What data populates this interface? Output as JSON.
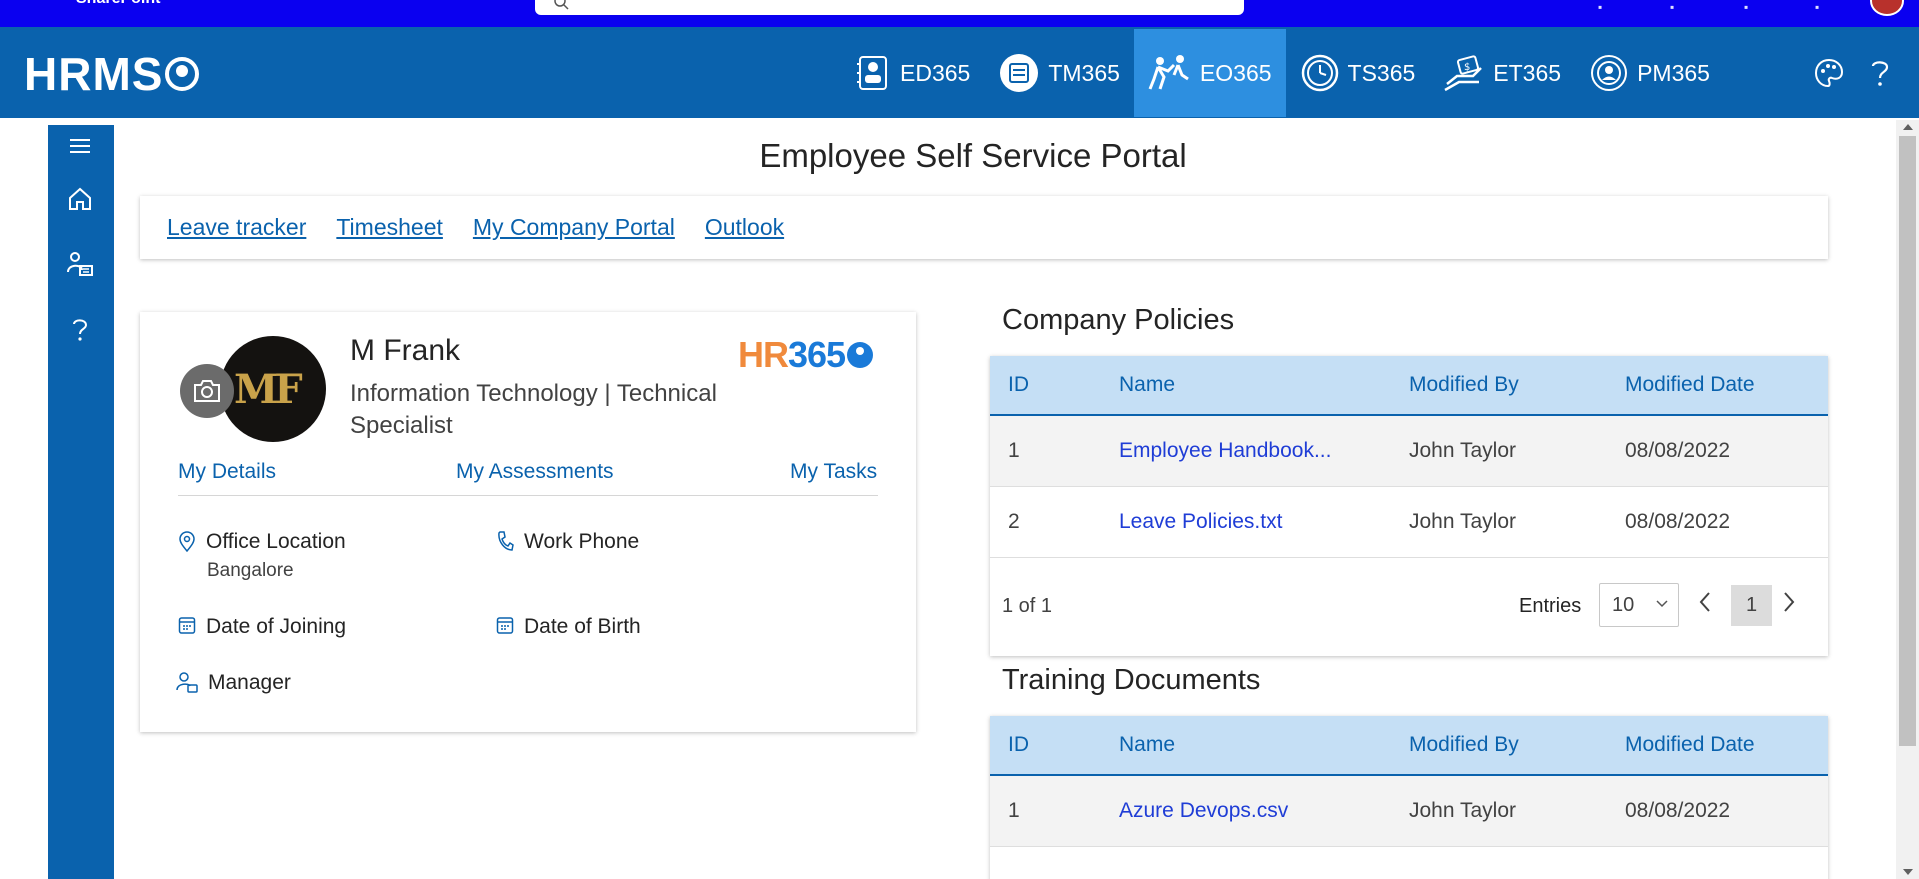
{
  "sharepoint_bar": {
    "brand": "SharePoint"
  },
  "header": {
    "logo": "HRMS",
    "nav": [
      {
        "label": "ED365",
        "icon": "employee-directory-icon",
        "active": false
      },
      {
        "label": "TM365",
        "icon": "task-management-icon",
        "active": false
      },
      {
        "label": "EO365",
        "icon": "employee-onboarding-icon",
        "active": true
      },
      {
        "label": "TS365",
        "icon": "timesheet-clock-icon",
        "active": false
      },
      {
        "label": "ET365",
        "icon": "expense-tracker-icon",
        "active": false
      },
      {
        "label": "PM365",
        "icon": "performance-management-icon",
        "active": false
      }
    ],
    "right_icons": [
      "palette-icon",
      "help-icon"
    ]
  },
  "sidebar": {
    "icons": [
      "hamburger-menu-icon",
      "home-icon",
      "people-org-icon",
      "help-icon"
    ]
  },
  "page_title": "Employee Self Service Portal",
  "quick_links": [
    "Leave tracker",
    "Timesheet",
    "My Company Portal",
    "Outlook"
  ],
  "profile": {
    "name": "M Frank",
    "department": "Information Technology | Technical Specialist",
    "avatar_monogram": "MF",
    "brand_logo": {
      "hr": "HR",
      "num": "365"
    },
    "tabs": [
      "My Details",
      "My Assessments",
      "My Tasks"
    ],
    "fields": {
      "office_location": {
        "label": "Office Location",
        "value": "Bangalore"
      },
      "work_phone": {
        "label": "Work Phone",
        "value": ""
      },
      "date_of_joining": {
        "label": "Date of Joining",
        "value": ""
      },
      "date_of_birth": {
        "label": "Date of Birth",
        "value": ""
      },
      "manager": {
        "label": "Manager",
        "value": ""
      }
    }
  },
  "company_policies": {
    "title": "Company Policies",
    "columns": [
      "ID",
      "Name",
      "Modified By",
      "Modified Date"
    ],
    "rows": [
      {
        "id": "1",
        "name": "Employee Handbook...",
        "modified_by": "John Taylor",
        "modified_date": "08/08/2022"
      },
      {
        "id": "2",
        "name": "Leave Policies.txt",
        "modified_by": "John Taylor",
        "modified_date": "08/08/2022"
      }
    ],
    "footer": {
      "count": "1 of 1",
      "entries_label": "Entries",
      "entries_value": "10",
      "current_page": "1"
    }
  },
  "training_documents": {
    "title": "Training Documents",
    "columns": [
      "ID",
      "Name",
      "Modified By",
      "Modified Date"
    ],
    "rows": [
      {
        "id": "1",
        "name": "Azure Devops.csv",
        "modified_by": "John Taylor",
        "modified_date": "08/08/2022"
      }
    ]
  },
  "colors": {
    "top_bar": "#0a00f0",
    "header": "#0a62ad",
    "active_nav": "#2d8fe0",
    "table_header": "#c5dff5",
    "link": "#0a62ad"
  }
}
